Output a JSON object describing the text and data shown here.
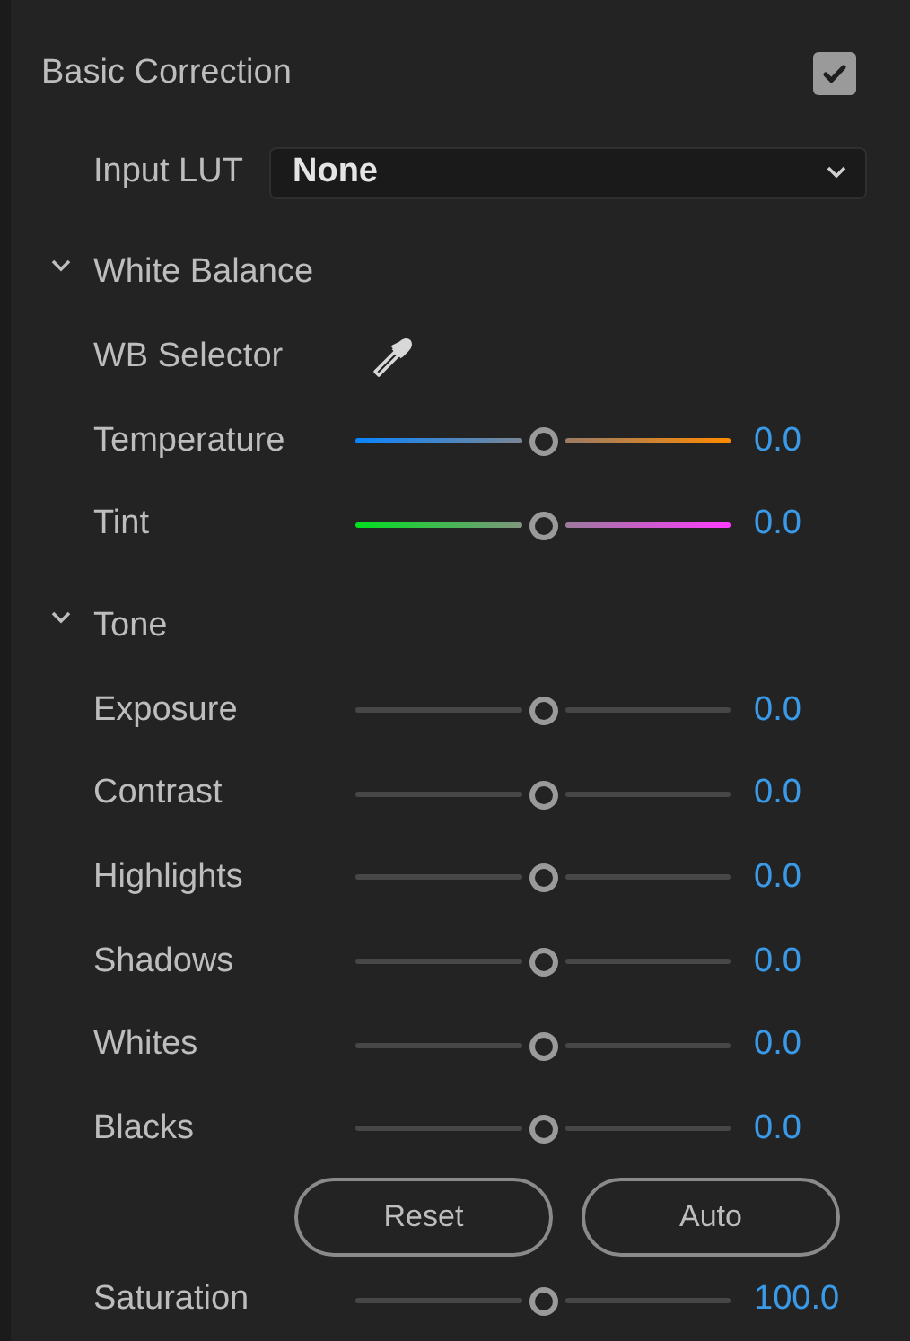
{
  "panel": {
    "title": "Basic Correction",
    "enabled": true
  },
  "input_lut": {
    "label": "Input LUT",
    "value": "None"
  },
  "sections": [
    {
      "title": "White Balance",
      "expanded": true,
      "rows": [
        {
          "kind": "picker",
          "label": "WB Selector"
        },
        {
          "kind": "temperature",
          "label": "Temperature",
          "level": 0.5,
          "value": "0.0"
        },
        {
          "kind": "tint",
          "label": "Tint",
          "level": 0.5,
          "value": "0.0"
        }
      ]
    },
    {
      "title": "Tone",
      "expanded": true,
      "rows": [
        {
          "kind": "plain",
          "label": "Exposure",
          "level": 0.5,
          "value": "0.0"
        },
        {
          "kind": "plain",
          "label": "Contrast",
          "level": 0.5,
          "value": "0.0"
        },
        {
          "kind": "plain",
          "label": "Highlights",
          "level": 0.5,
          "value": "0.0"
        },
        {
          "kind": "plain",
          "label": "Shadows",
          "level": 0.5,
          "value": "0.0"
        },
        {
          "kind": "plain",
          "label": "Whites",
          "level": 0.5,
          "value": "0.0"
        },
        {
          "kind": "plain",
          "label": "Blacks",
          "level": 0.5,
          "value": "0.0"
        },
        {
          "kind": "buttons",
          "buttons": [
            "Reset",
            "Auto"
          ]
        },
        {
          "kind": "plain",
          "label": "Saturation",
          "level": 0.5,
          "value": "100.0"
        }
      ]
    }
  ]
}
